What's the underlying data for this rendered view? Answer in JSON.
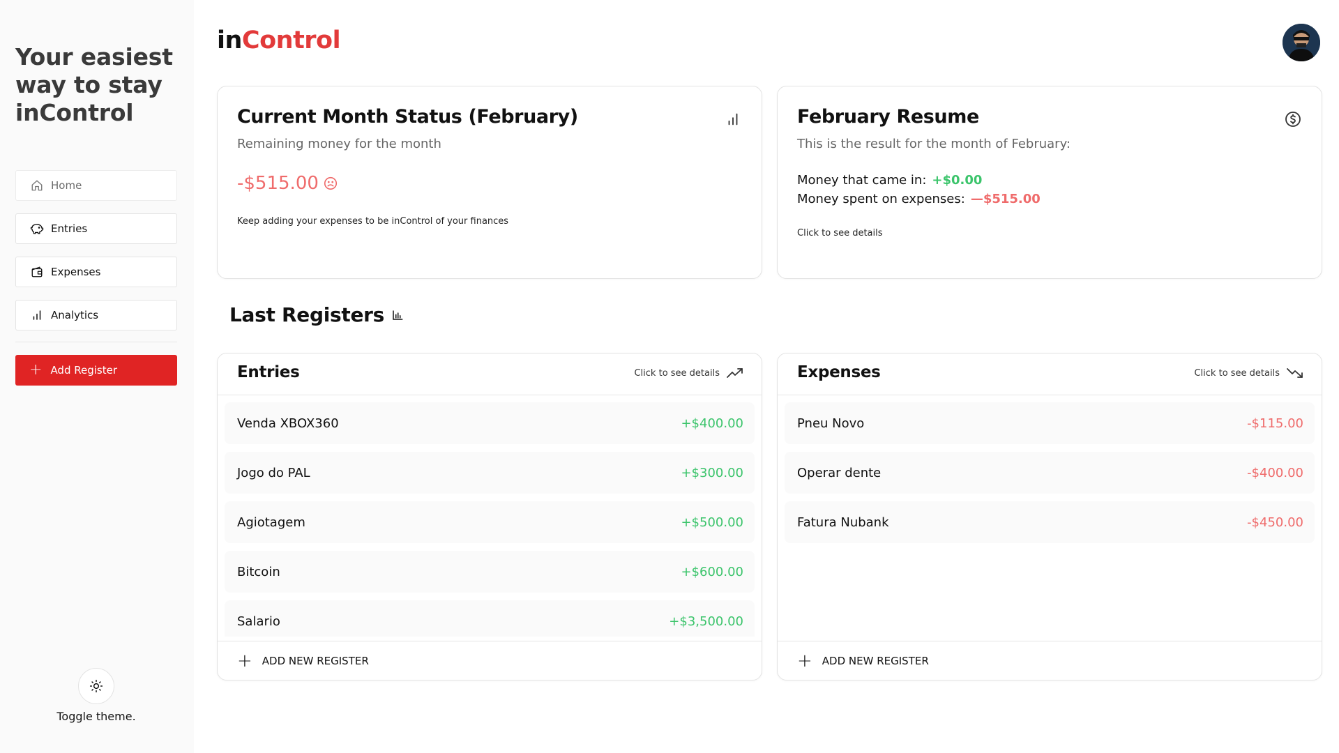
{
  "app": {
    "logo_in": "in",
    "logo_control": "Control",
    "accent_color": "#e23a3a"
  },
  "sidebar": {
    "tagline": "Your easiest way to stay inControl",
    "items": [
      {
        "label": "Home",
        "icon": "home-icon"
      },
      {
        "label": "Entries",
        "icon": "piggy-bank-icon"
      },
      {
        "label": "Expenses",
        "icon": "wallet-icon"
      },
      {
        "label": "Analytics",
        "icon": "bar-chart-icon"
      }
    ],
    "add_register_label": "Add Register",
    "toggle_theme_label": "Toggle theme."
  },
  "status_card": {
    "title": "Current Month Status (February)",
    "subtitle": "Remaining money for the month",
    "remaining": "-$515.00",
    "message": "Keep adding your expenses to be inControl of your finances",
    "icon": "bar-chart-icon"
  },
  "resume_card": {
    "title": "February Resume",
    "subtitle": "This is the result for the month of February:",
    "came_in_label": "Money that came in:",
    "came_in_value": "+$0.00",
    "spent_label": "Money spent on expenses:",
    "spent_value": "—$515.00",
    "click_label": "Click to see details",
    "icon": "dollar-circle-icon"
  },
  "last_registers": {
    "title": "Last Registers"
  },
  "entries_list": {
    "title": "Entries",
    "link_label": "Click to see details",
    "add_label": "ADD NEW REGISTER",
    "rows": [
      {
        "name": "Venda XBOX360",
        "amount": "+$400.00"
      },
      {
        "name": "Jogo do PAL",
        "amount": "+$300.00"
      },
      {
        "name": "Agiotagem",
        "amount": "+$500.00"
      },
      {
        "name": "Bitcoin",
        "amount": "+$600.00"
      },
      {
        "name": "Salario",
        "amount": "+$3,500.00"
      }
    ]
  },
  "expenses_list": {
    "title": "Expenses",
    "link_label": "Click to see details",
    "add_label": "ADD NEW REGISTER",
    "rows": [
      {
        "name": "Pneu Novo",
        "amount": "-$115.00"
      },
      {
        "name": "Operar dente",
        "amount": "-$400.00"
      },
      {
        "name": "Fatura Nubank",
        "amount": "-$450.00"
      }
    ]
  }
}
